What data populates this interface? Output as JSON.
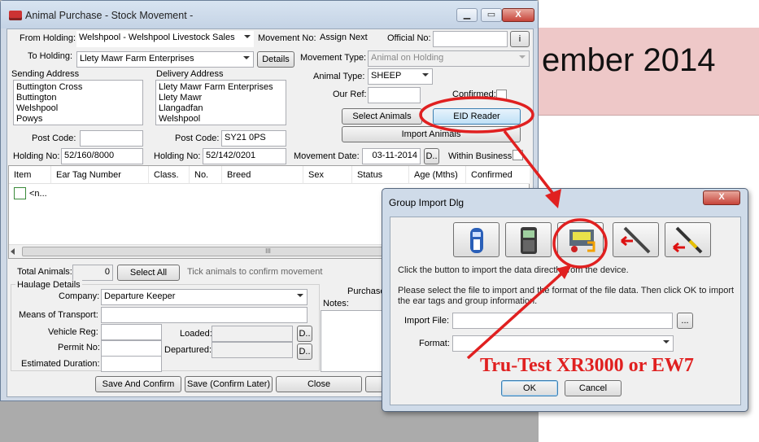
{
  "background_title": "ember 2014",
  "window": {
    "title": "Animal Purchase - Stock Movement -",
    "controls": {
      "minimize": "▁",
      "maximize": "▭",
      "close": "X"
    }
  },
  "form": {
    "from_holding_label": "From Holding:",
    "from_holding_value": "Welshpool - Welshpool Livestock Sales",
    "to_holding_label": "To Holding:",
    "to_holding_value": "Llety Mawr Farm Enterprises",
    "details_button": "Details",
    "movement_no_label": "Movement No:",
    "movement_no_value": "Assign Next",
    "official_no_label": "Official No:",
    "official_no_value": "",
    "info_button": "i",
    "movement_type_label": "Movement Type:",
    "movement_type_value": "Animal on Holding",
    "sending_address_label": "Sending Address",
    "sending_address_lines": [
      "Buttington Cross",
      "Buttington",
      "Welshpool",
      "Powys"
    ],
    "delivery_address_label": "Delivery Address",
    "delivery_address_lines": [
      "Llety Mawr Farm Enterprises",
      "Llety Mawr",
      "Llangadfan",
      "Welshpool"
    ],
    "animal_type_label": "Animal Type:",
    "animal_type_value": "SHEEP",
    "our_ref_label": "Our Ref:",
    "our_ref_value": "",
    "confirmed_label": "Confirmed:",
    "select_animals_button": "Select Animals",
    "eid_reader_button": "EID Reader",
    "import_animals_button": "Import Animals",
    "post_code_label": "Post Code:",
    "sending_post_code": "",
    "delivery_post_code_label": "Post Code:",
    "delivery_post_code": "SY21 0PS",
    "holding_no_label": "Holding No:",
    "sending_holding_no": "52/160/8000",
    "delivery_holding_no_label": "Holding No:",
    "delivery_holding_no": "52/142/0201",
    "movement_date_label": "Movement Date:",
    "movement_date_value": "03-11-2014",
    "date_button": "D..",
    "within_business_label": "Within Business"
  },
  "grid": {
    "headers": [
      "Item",
      "Ear Tag Number",
      "Class.",
      "No.",
      "Breed",
      "Sex",
      "Status",
      "Age (Mths)",
      "Confirmed"
    ],
    "row1_item": "<n...",
    "scroll_thumb": "III"
  },
  "totals": {
    "total_animals_label": "Total Animals:",
    "total_animals_value": "0",
    "select_all_button": "Select All",
    "tick_hint": "Tick animals to confirm movement"
  },
  "haulage": {
    "section_label": "Haulage Details",
    "company_label": "Company:",
    "company_value": "Departure Keeper",
    "means_label": "Means of Transport:",
    "means_value": "",
    "vehicle_reg_label": "Vehicle Reg:",
    "vehicle_reg_value": "",
    "permit_label": "Permit No:",
    "permit_value": "",
    "duration_label": "Estimated Duration:",
    "duration_value": "",
    "loaded_label": "Loaded:",
    "departured_label": "Departured:",
    "date_button": "D..",
    "purchase_label": "Purchase",
    "notes_label": "Notes:"
  },
  "footer": {
    "save_confirm": "Save And Confirm",
    "save_later": "Save (Confirm Later)",
    "close": "Close"
  },
  "dialog": {
    "title": "Group Import Dlg",
    "close": "X",
    "instruction1": "Click the  button to import the data directly from the device.",
    "instruction2": "Please select the file to import and the format of the file data. Then click OK to import the ear tags and group information.",
    "import_file_label": "Import File:",
    "import_file_value": "",
    "browse_button": "...",
    "format_label": "Format:",
    "format_value": "",
    "ok_button": "OK",
    "cancel_button": "Cancel"
  },
  "annotation": {
    "text": "Tru-Test XR3000 or EW7",
    "color": "#e02020"
  }
}
